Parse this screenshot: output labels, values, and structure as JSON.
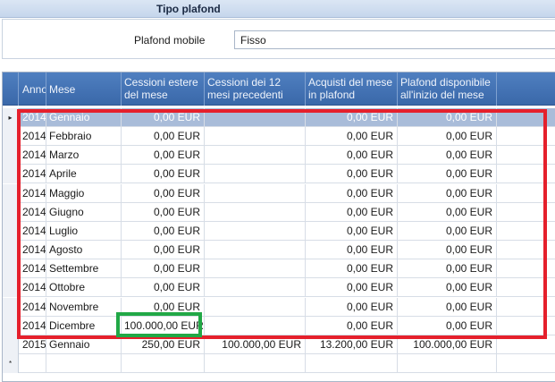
{
  "section": {
    "title": "Tipo plafond"
  },
  "plafond": {
    "label": "Plafond mobile",
    "value": "Fisso"
  },
  "grid": {
    "headers": [
      "Anno",
      "Mese",
      "Cessioni estere del mese",
      "Cessioni dei 12 mesi precedenti",
      "Acquisti del mese in plafond",
      "Plafond disponibile all'inizio del mese"
    ],
    "rows": [
      {
        "anno": "2014",
        "mese": "Gennaio",
        "cessioni": "0,00 EUR",
        "cessioni12": "",
        "acquisti": "0,00 EUR",
        "plafond": "0,00 EUR"
      },
      {
        "anno": "2014",
        "mese": "Febbraio",
        "cessioni": "0,00 EUR",
        "cessioni12": "",
        "acquisti": "0,00 EUR",
        "plafond": "0,00 EUR"
      },
      {
        "anno": "2014",
        "mese": "Marzo",
        "cessioni": "0,00 EUR",
        "cessioni12": "",
        "acquisti": "0,00 EUR",
        "plafond": "0,00 EUR"
      },
      {
        "anno": "2014",
        "mese": "Aprile",
        "cessioni": "0,00 EUR",
        "cessioni12": "",
        "acquisti": "0,00 EUR",
        "plafond": "0,00 EUR"
      },
      {
        "anno": "2014",
        "mese": "Maggio",
        "cessioni": "0,00 EUR",
        "cessioni12": "",
        "acquisti": "0,00 EUR",
        "plafond": "0,00 EUR"
      },
      {
        "anno": "2014",
        "mese": "Giugno",
        "cessioni": "0,00 EUR",
        "cessioni12": "",
        "acquisti": "0,00 EUR",
        "plafond": "0,00 EUR"
      },
      {
        "anno": "2014",
        "mese": "Luglio",
        "cessioni": "0,00 EUR",
        "cessioni12": "",
        "acquisti": "0,00 EUR",
        "plafond": "0,00 EUR"
      },
      {
        "anno": "2014",
        "mese": "Agosto",
        "cessioni": "0,00 EUR",
        "cessioni12": "",
        "acquisti": "0,00 EUR",
        "plafond": "0,00 EUR"
      },
      {
        "anno": "2014",
        "mese": "Settembre",
        "cessioni": "0,00 EUR",
        "cessioni12": "",
        "acquisti": "0,00 EUR",
        "plafond": "0,00 EUR"
      },
      {
        "anno": "2014",
        "mese": "Ottobre",
        "cessioni": "0,00 EUR",
        "cessioni12": "",
        "acquisti": "0,00 EUR",
        "plafond": "0,00 EUR"
      },
      {
        "anno": "2014",
        "mese": "Novembre",
        "cessioni": "0,00 EUR",
        "cessioni12": "",
        "acquisti": "0,00 EUR",
        "plafond": "0,00 EUR"
      },
      {
        "anno": "2014",
        "mese": "Dicembre",
        "cessioni": "100.000,00 EUR",
        "cessioni12": "",
        "acquisti": "0,00 EUR",
        "plafond": "0,00 EUR"
      },
      {
        "anno": "2015",
        "mese": "Gennaio",
        "cessioni": "250,00 EUR",
        "cessioni12": "100.000,00 EUR",
        "acquisti": "13.200,00 EUR",
        "plafond": "100.000,00 EUR"
      }
    ],
    "current_row_marker": "▸",
    "new_row_marker": "*"
  },
  "colors": {
    "header_bg": "#4a78b8",
    "selected_row": "#a9bcd9",
    "highlight_red": "#e5202c",
    "highlight_green": "#21a846"
  }
}
